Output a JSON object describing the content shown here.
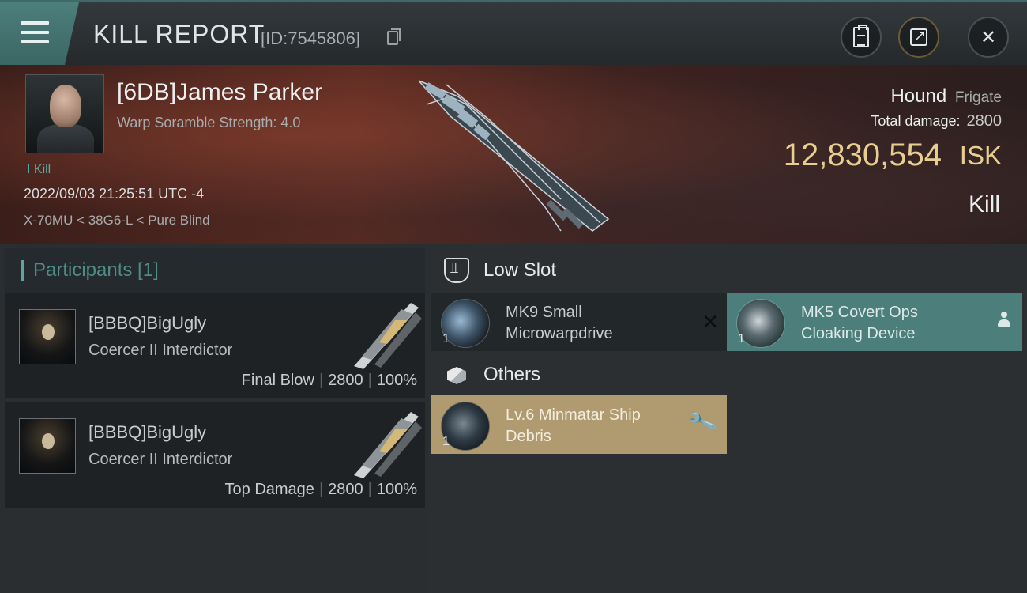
{
  "header": {
    "title": "KILL REPORT",
    "report_id": "[ID:7545806]"
  },
  "victim": {
    "name": "[6DB]James Parker",
    "scramble_strength": "Warp Soramble Strength: 4.0",
    "kills_label": "I Kill",
    "datetime": "2022/09/03 21:25:51 UTC -4",
    "location": "X-70MU < 38G6-L < Pure Blind",
    "ship_name": "Hound",
    "ship_class": "Frigate",
    "total_damage_label": "Total damage:",
    "total_damage": "2800",
    "isk_value": "12,830,554",
    "isk_unit": "ISK",
    "report_type": "Kill"
  },
  "participants": {
    "header": "Participants [1]",
    "items": [
      {
        "name": "[BBBQ]BigUgly",
        "ship": "Coercer II Interdictor",
        "role": "Final Blow",
        "damage": "2800",
        "percent": "100%",
        "sep": "|"
      },
      {
        "name": "[BBBQ]BigUgly",
        "ship": "Coercer II Interdictor",
        "role": "Top Damage",
        "damage": "2800",
        "percent": "100%",
        "sep": "|"
      }
    ]
  },
  "modules": {
    "low_slot_label": "Low Slot",
    "others_label": "Others",
    "low_slot": [
      {
        "name_line1": "MK9 Small",
        "name_line2": "Microwarpdrive",
        "qty": "1",
        "status": "destroyed"
      },
      {
        "name_line1": "MK5 Covert Ops",
        "name_line2": "Cloaking Device",
        "qty": "1",
        "status": "dropped"
      }
    ],
    "others": [
      {
        "name_line1": "Lv.6 Minmatar Ship",
        "name_line2": "Debris",
        "qty": "1",
        "status": "salvage"
      }
    ]
  },
  "colors": {
    "accent": "#4c7f7c",
    "isk_gold": "#e9cf8f",
    "debris_tile": "#b09a70"
  }
}
